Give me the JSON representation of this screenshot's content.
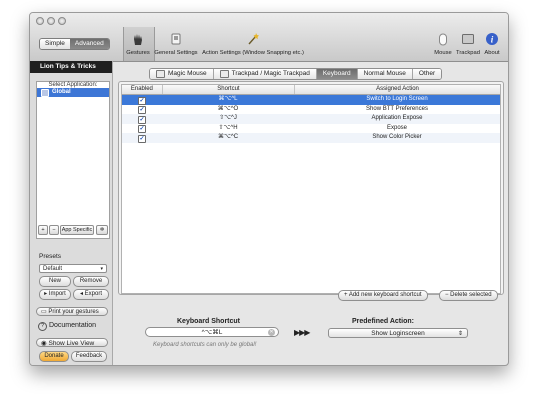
{
  "toolbar": {
    "mode_simple": "Simple",
    "mode_advanced": "Advanced",
    "items": {
      "gestures": "Gestures",
      "general": "General Settings",
      "action_settings": "Action Settings (Window Snapping etc.)",
      "mouse": "Mouse",
      "trackpad": "Trackpad",
      "about": "About"
    }
  },
  "sidebar": {
    "tips": "Lion Tips & Tricks",
    "select_app_title": "Select Application:",
    "app_global": "Global",
    "add": "+",
    "remove": "−",
    "app_specific": "App Specific",
    "presets_label": "Presets",
    "preset_value": "Default",
    "new": "New",
    "remove_preset": "Remove",
    "import": "Import",
    "export": "Export",
    "print_gestures": "Print your gestures",
    "documentation": "Documentation",
    "show_live_view": "Show Live View",
    "donate": "Donate",
    "feedback": "Feedback"
  },
  "tabs": [
    "Magic Mouse",
    "Trackpad / Magic Trackpad",
    "Keyboard",
    "Normal Mouse",
    "Other"
  ],
  "active_tab": "Keyboard",
  "table": {
    "headers": [
      "Enabled",
      "Shortcut",
      "Assigned Action"
    ],
    "rows": [
      {
        "enabled": true,
        "shortcut": "⌘⌥^L",
        "action": "Switch to Login Screen"
      },
      {
        "enabled": true,
        "shortcut": "⌘⌥^O",
        "action": "Show BTT Preferences"
      },
      {
        "enabled": true,
        "shortcut": "⇧⌥^J",
        "action": "Application Expose"
      },
      {
        "enabled": true,
        "shortcut": "⇧⌥^H",
        "action": "Expose"
      },
      {
        "enabled": true,
        "shortcut": "⌘⌥^C",
        "action": "Show Color Picker"
      }
    ],
    "selected_row": 0
  },
  "actions": {
    "add_shortcut": "Add new keyboard shortcut",
    "delete_selected": "Delete selected"
  },
  "detail": {
    "keyboard_shortcut_label": "Keyboard Shortcut",
    "shortcut_value": "^⌥⌘L",
    "hint": "Keyboard shortcuts can only be global!",
    "arrows": "▶▶▶",
    "predefined_label": "Predefined Action:",
    "predefined_value": "Show Loginscreen"
  },
  "colors": {
    "selection": "#3b78d8",
    "sidebar_header": "#1f1f1f",
    "donate": "#f2b233"
  }
}
